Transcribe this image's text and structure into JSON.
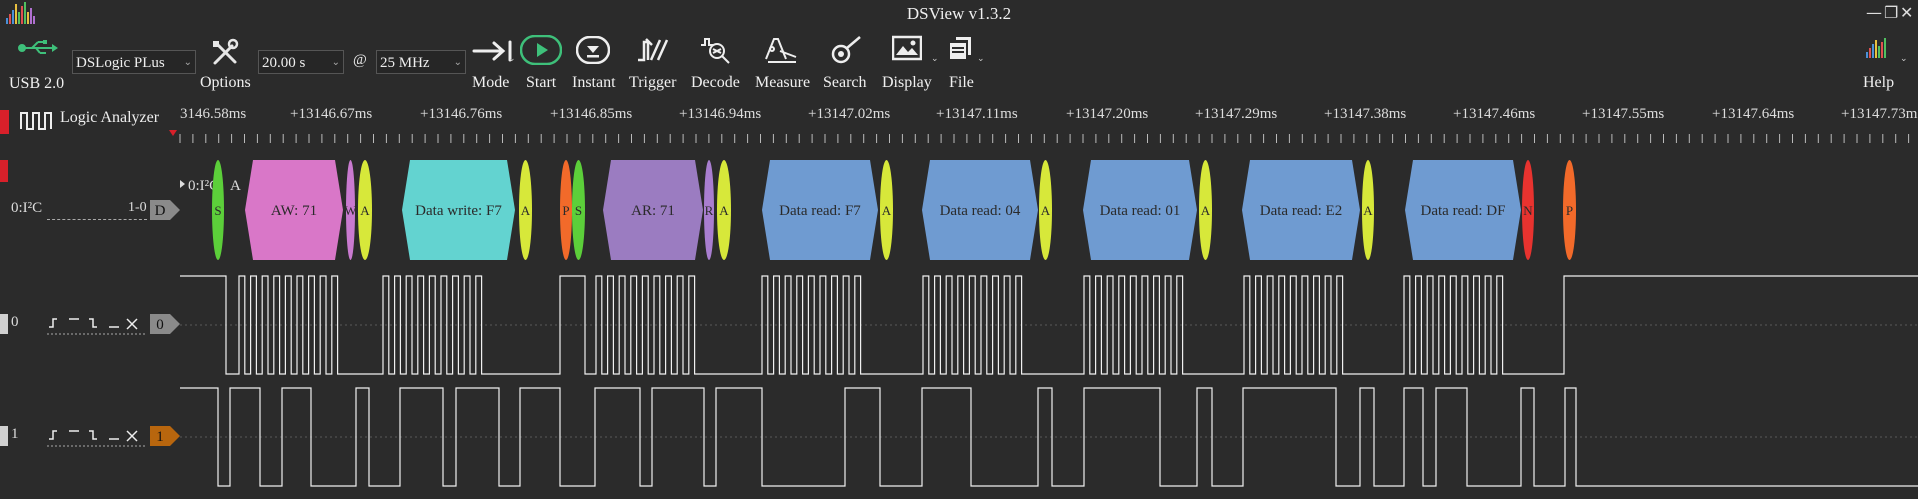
{
  "app": {
    "title": "DSView v1.3.2"
  },
  "window_controls": {
    "minimize": "—",
    "restore": "❐",
    "close": "✕"
  },
  "toolbar": {
    "usb_label": "USB 2.0",
    "device": "DSLogic PLus",
    "options_label": "Options",
    "duration": "20.00 s",
    "at": "@",
    "rate": "25 MHz",
    "mode_label": "Mode",
    "start_label": "Start",
    "instant_label": "Instant",
    "trigger_label": "Trigger",
    "decode_label": "Decode",
    "measure_label": "Measure",
    "search_label": "Search",
    "display_label": "Display",
    "file_label": "File",
    "help_label": "Help",
    "accent_start": "#3ec07a"
  },
  "timeline": {
    "panel_title": "Logic Analyzer",
    "ticks": [
      "3146.58ms",
      "+13146.67ms",
      "+13146.76ms",
      "+13146.85ms",
      "+13146.94ms",
      "+13147.02ms",
      "+13147.11ms",
      "+13147.20ms",
      "+13147.29ms",
      "+13147.38ms",
      "+13147.46ms",
      "+13147.55ms",
      "+13147.64ms",
      "+13147.73m"
    ]
  },
  "channels": {
    "decoder": {
      "name": "0:I²C",
      "range": "1-0",
      "badge": "D",
      "row_label": "0:I²C",
      "row_tag": "A"
    },
    "ch0": {
      "index": "0",
      "badge": "0"
    },
    "ch1": {
      "index": "1",
      "badge": "1"
    }
  },
  "decoder_annotations": [
    {
      "text": "S",
      "color": "#5ccf3a"
    },
    {
      "text": "AW: 71",
      "color": "#d977c8"
    },
    {
      "text": "W",
      "color": "#c97ad0"
    },
    {
      "text": "A",
      "color": "#d7e83a"
    },
    {
      "text": "Data write: F7",
      "color": "#63d3d0"
    },
    {
      "text": "A",
      "color": "#d7e83a"
    },
    {
      "text": "P",
      "color": "#f26a2a"
    },
    {
      "text": "S",
      "color": "#5ccf3a"
    },
    {
      "text": "AR: 71",
      "color": "#9b7cc1"
    },
    {
      "text": "R",
      "color": "#a97ed0"
    },
    {
      "text": "A",
      "color": "#d7e83a"
    },
    {
      "text": "Data read: F7",
      "color": "#6f9bd1"
    },
    {
      "text": "A",
      "color": "#d7e83a"
    },
    {
      "text": "Data read: 04",
      "color": "#6f9bd1"
    },
    {
      "text": "A",
      "color": "#d7e83a"
    },
    {
      "text": "Data read: 01",
      "color": "#6f9bd1"
    },
    {
      "text": "A",
      "color": "#d7e83a"
    },
    {
      "text": "Data read: E2",
      "color": "#6f9bd1"
    },
    {
      "text": "A",
      "color": "#d7e83a"
    },
    {
      "text": "Data read: DF",
      "color": "#6f9bd1"
    },
    {
      "text": "N",
      "color": "#e8332f"
    },
    {
      "text": "P",
      "color": "#f26a2a"
    }
  ],
  "colors": {
    "channel_red": "#d8202a",
    "badge_gray": "#8a8a8a",
    "badge_orange": "#b8660e",
    "grid": "#5a5a5a"
  }
}
